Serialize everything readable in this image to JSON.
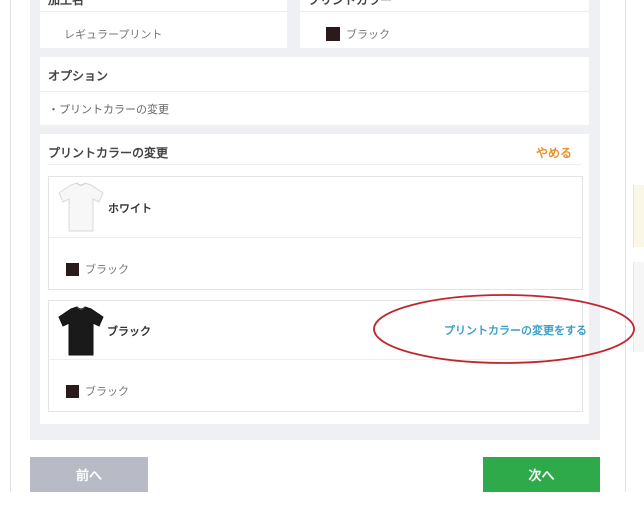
{
  "top_cards": {
    "left": {
      "label": "加工名",
      "value": "レギュラープリント"
    },
    "right": {
      "label": "プリントカラー",
      "value": "ブラック",
      "swatch_color": "#2b1a1c"
    }
  },
  "options": {
    "title": "オプション",
    "item": "・プリントカラーの変更"
  },
  "print_color_change": {
    "title": "プリントカラーの変更",
    "cancel_label": "やめる",
    "items": [
      {
        "shirt_color_name": "ホワイト",
        "shirt_fill": "#f7f7f7",
        "print_color": "ブラック",
        "print_swatch": "#2b1a1c",
        "action_label": ""
      },
      {
        "shirt_color_name": "ブラック",
        "shirt_fill": "#1a1a1a",
        "print_color": "ブラック",
        "print_swatch": "#2b1a1c",
        "action_label": "プリントカラーの変更をする"
      }
    ]
  },
  "nav": {
    "prev_label": "前へ",
    "next_label": "次へ"
  },
  "colors": {
    "accent_orange": "#e8922c",
    "link_blue": "#3b9fc7",
    "next_green": "#2eaa4a",
    "prev_gray": "#b8bbc5",
    "annotation_red": "#c0262b"
  },
  "icons": [
    "tshirt-white-icon",
    "tshirt-black-icon"
  ]
}
